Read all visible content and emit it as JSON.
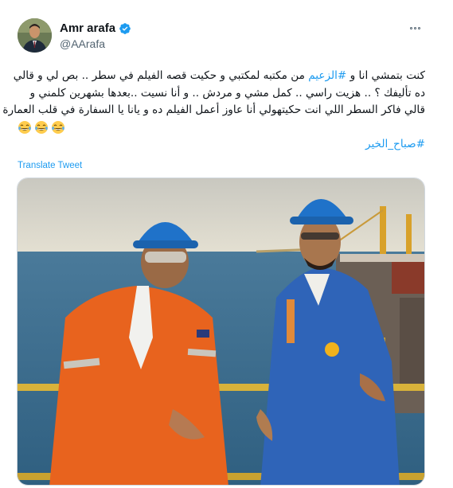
{
  "author": {
    "name": "Amr arafa",
    "handle": "@AArafa",
    "verified": true,
    "avatar_icon": "profile-avatar",
    "verified_icon": "verified-badge-icon"
  },
  "more_icon": "more-options-icon",
  "tweet": {
    "lines": [
      {
        "before": "كنت بتمشي انا و ",
        "hashtag": "#الزعيم",
        "after": " من مكتبه لمكتبي و حكيت قصه الفيلم في سطر .. بص لي و قالي"
      },
      {
        "text": "ده تأليفك ؟ .. هزيت راسي .. كمل مشي و مردش .. و أنا نسيت ..بعدها بشهرين كلمني و"
      },
      {
        "text": "قالي فاكر السطر اللي انت حكيتهولي أنا عاوز أعمل الفيلم ده و يانا يا السفارة في قلب العمارة"
      }
    ],
    "emoji": [
      "😂",
      "😂",
      "😂"
    ],
    "emoji_icon": "laughing-tears-emoji",
    "closing_hashtag": "#صباح_الخير"
  },
  "translate_label": "Translate Tweet",
  "colors": {
    "link": "#1d9bf0",
    "text": "#0f1419",
    "secondary": "#536471",
    "orange_coverall": "#e8631e",
    "blue_coverall": "#2f64b8",
    "hard_hat": "#1f72c9"
  }
}
